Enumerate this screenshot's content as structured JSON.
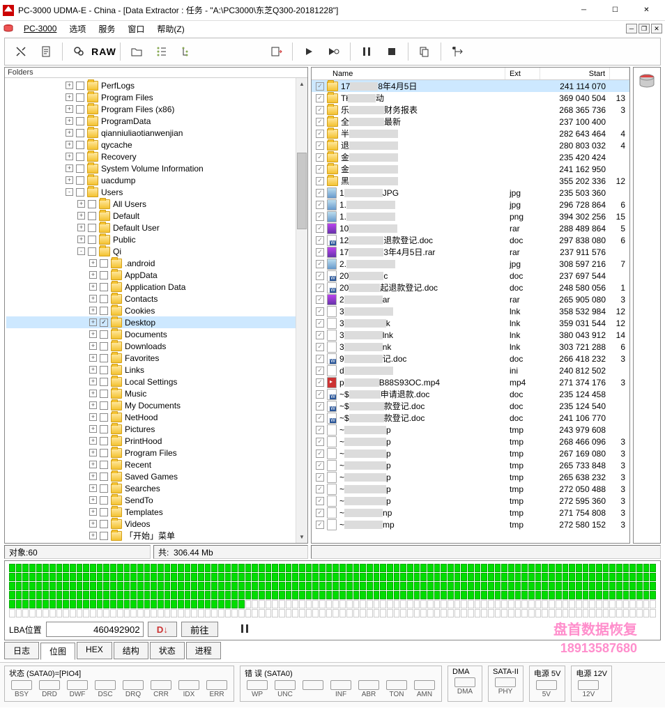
{
  "title": "PC-3000 UDMA-E - China - [Data Extractor : 任务 - \"A:\\PC3000\\东芝Q300-20181228\"]",
  "menus": {
    "app": "PC-3000",
    "items": [
      "选项",
      "服务",
      "窗口",
      "帮助(Z)"
    ]
  },
  "toolbar_raw": "RAW",
  "folders_title": "Folders",
  "tree": [
    {
      "indent": 5,
      "exp": "+",
      "cb": false,
      "label": "PerfLogs"
    },
    {
      "indent": 5,
      "exp": "+",
      "cb": false,
      "label": "Program Files"
    },
    {
      "indent": 5,
      "exp": "+",
      "cb": false,
      "label": "Program Files (x86)"
    },
    {
      "indent": 5,
      "exp": "+",
      "cb": false,
      "label": "ProgramData"
    },
    {
      "indent": 5,
      "exp": "+",
      "cb": false,
      "label": "qianniuliaotianwenjian"
    },
    {
      "indent": 5,
      "exp": "+",
      "cb": false,
      "label": "qycache"
    },
    {
      "indent": 5,
      "exp": "+",
      "cb": false,
      "label": "Recovery"
    },
    {
      "indent": 5,
      "exp": "+",
      "cb": false,
      "label": "System Volume Information"
    },
    {
      "indent": 5,
      "exp": "+",
      "cb": false,
      "label": "uacdump"
    },
    {
      "indent": 5,
      "exp": "-",
      "cb": false,
      "label": "Users"
    },
    {
      "indent": 6,
      "exp": "+",
      "cb": false,
      "label": "All Users"
    },
    {
      "indent": 6,
      "exp": "+",
      "cb": false,
      "label": "Default"
    },
    {
      "indent": 6,
      "exp": "+",
      "cb": false,
      "label": "Default User"
    },
    {
      "indent": 6,
      "exp": "+",
      "cb": false,
      "label": "Public"
    },
    {
      "indent": 6,
      "exp": "-",
      "cb": false,
      "label": "Qi"
    },
    {
      "indent": 7,
      "exp": "+",
      "cb": false,
      "label": ".android"
    },
    {
      "indent": 7,
      "exp": "+",
      "cb": false,
      "label": "AppData"
    },
    {
      "indent": 7,
      "exp": "+",
      "cb": false,
      "label": "Application Data"
    },
    {
      "indent": 7,
      "exp": "+",
      "cb": false,
      "label": "Contacts"
    },
    {
      "indent": 7,
      "exp": "+",
      "cb": false,
      "label": "Cookies"
    },
    {
      "indent": 7,
      "exp": "+",
      "cb": true,
      "label": "Desktop",
      "sel": true
    },
    {
      "indent": 7,
      "exp": "+",
      "cb": false,
      "label": "Documents"
    },
    {
      "indent": 7,
      "exp": "+",
      "cb": false,
      "label": "Downloads"
    },
    {
      "indent": 7,
      "exp": "+",
      "cb": false,
      "label": "Favorites"
    },
    {
      "indent": 7,
      "exp": "+",
      "cb": false,
      "label": "Links"
    },
    {
      "indent": 7,
      "exp": "+",
      "cb": false,
      "label": "Local Settings"
    },
    {
      "indent": 7,
      "exp": "+",
      "cb": false,
      "label": "Music"
    },
    {
      "indent": 7,
      "exp": "+",
      "cb": false,
      "label": "My Documents"
    },
    {
      "indent": 7,
      "exp": "+",
      "cb": false,
      "label": "NetHood"
    },
    {
      "indent": 7,
      "exp": "+",
      "cb": false,
      "label": "Pictures"
    },
    {
      "indent": 7,
      "exp": "+",
      "cb": false,
      "label": "PrintHood"
    },
    {
      "indent": 7,
      "exp": "+",
      "cb": false,
      "label": "Program Files"
    },
    {
      "indent": 7,
      "exp": "+",
      "cb": false,
      "label": "Recent"
    },
    {
      "indent": 7,
      "exp": "+",
      "cb": false,
      "label": "Saved Games"
    },
    {
      "indent": 7,
      "exp": "+",
      "cb": false,
      "label": "Searches"
    },
    {
      "indent": 7,
      "exp": "+",
      "cb": false,
      "label": "SendTo"
    },
    {
      "indent": 7,
      "exp": "+",
      "cb": false,
      "label": "Templates"
    },
    {
      "indent": 7,
      "exp": "+",
      "cb": false,
      "label": "Videos"
    },
    {
      "indent": 7,
      "exp": "+",
      "cb": false,
      "label": "「开始」菜单"
    }
  ],
  "cols": {
    "name": "Name",
    "ext": "Ext",
    "start": "Start"
  },
  "files": [
    {
      "ico": "folder",
      "pre": "17",
      "mid": 40,
      "post": "8年4月5日",
      "ext": "",
      "start": "241 114 070",
      "end": "",
      "sel": true
    },
    {
      "ico": "folder",
      "pre": "Tł",
      "mid": 40,
      "post": "动",
      "ext": "",
      "start": "369 040 504",
      "end": "13"
    },
    {
      "ico": "folder",
      "pre": "乐",
      "mid": 50,
      "post": "财务报表",
      "ext": "",
      "start": "268 365 736",
      "end": "3"
    },
    {
      "ico": "folder",
      "pre": "全",
      "mid": 50,
      "post": "最新",
      "ext": "",
      "start": "237 100 400",
      "end": ""
    },
    {
      "ico": "folder",
      "pre": "半",
      "mid": 70,
      "post": "",
      "ext": "",
      "start": "282 643 464",
      "end": "4"
    },
    {
      "ico": "folder",
      "pre": "退",
      "mid": 70,
      "post": "",
      "ext": "",
      "start": "280 803 032",
      "end": "4"
    },
    {
      "ico": "folder",
      "pre": "金",
      "mid": 70,
      "post": "",
      "ext": "",
      "start": "235 420 424",
      "end": ""
    },
    {
      "ico": "folder",
      "pre": "金",
      "mid": 70,
      "post": "",
      "ext": "",
      "start": "241 162 950",
      "end": ""
    },
    {
      "ico": "folder",
      "pre": "黑",
      "mid": 70,
      "post": "",
      "ext": "",
      "start": "355 202 336",
      "end": "12"
    },
    {
      "ico": "img",
      "pre": "1",
      "mid": 55,
      "post": "JPG",
      "ext": "jpg",
      "start": "235 503 360",
      "end": ""
    },
    {
      "ico": "img",
      "pre": "1.",
      "mid": 70,
      "post": "",
      "ext": "jpg",
      "start": "296 728 864",
      "end": "6"
    },
    {
      "ico": "img",
      "pre": "1.",
      "mid": 70,
      "post": "",
      "ext": "png",
      "start": "394 302 256",
      "end": "15"
    },
    {
      "ico": "rar",
      "pre": "10",
      "mid": 70,
      "post": "",
      "ext": "rar",
      "start": "288 489 864",
      "end": "5"
    },
    {
      "ico": "w",
      "pre": "12",
      "mid": 50,
      "post": "退款登记.doc",
      "ext": "doc",
      "start": "297 838 080",
      "end": "6"
    },
    {
      "ico": "rar",
      "pre": "17",
      "mid": 50,
      "post": "3年4月5日.rar",
      "ext": "rar",
      "start": "237 911 576",
      "end": ""
    },
    {
      "ico": "img",
      "pre": "2.",
      "mid": 70,
      "post": "",
      "ext": "jpg",
      "start": "308 597 216",
      "end": "7"
    },
    {
      "ico": "w",
      "pre": "20",
      "mid": 50,
      "post": "c",
      "ext": "doc",
      "start": "237 697 544",
      "end": ""
    },
    {
      "ico": "w",
      "pre": "20",
      "mid": 45,
      "post": "起退款登记.doc",
      "ext": "doc",
      "start": "248 580 056",
      "end": "1"
    },
    {
      "ico": "rar",
      "pre": "2",
      "mid": 55,
      "post": "ar",
      "ext": "rar",
      "start": "265 905 080",
      "end": "3"
    },
    {
      "ico": "file",
      "pre": "3",
      "mid": 70,
      "post": "",
      "ext": "lnk",
      "start": "358 532 984",
      "end": "12"
    },
    {
      "ico": "file",
      "pre": "3",
      "mid": 60,
      "post": "k",
      "ext": "lnk",
      "start": "359 031 544",
      "end": "12"
    },
    {
      "ico": "file",
      "pre": "3",
      "mid": 55,
      "post": "lnk",
      "ext": "lnk",
      "start": "380 043 912",
      "end": "14"
    },
    {
      "ico": "file",
      "pre": "3",
      "mid": 55,
      "post": "nk",
      "ext": "lnk",
      "start": "303 721 288",
      "end": "6"
    },
    {
      "ico": "w",
      "pre": "9",
      "mid": 55,
      "post": "记.doc",
      "ext": "doc",
      "start": "266 418 232",
      "end": "3"
    },
    {
      "ico": "file",
      "pre": "d",
      "mid": 70,
      "post": "",
      "ext": "ini",
      "start": "240 812 502",
      "end": ""
    },
    {
      "ico": "vid",
      "pre": "p",
      "mid": 50,
      "post": "B88S93OC.mp4",
      "ext": "mp4",
      "start": "271 374 176",
      "end": "3"
    },
    {
      "ico": "w",
      "pre": "~$",
      "mid": 45,
      "post": "申请退款.doc",
      "ext": "doc",
      "start": "235 124 458",
      "end": ""
    },
    {
      "ico": "w",
      "pre": "~$",
      "mid": 50,
      "post": "款登记.doc",
      "ext": "doc",
      "start": "235 124 540",
      "end": ""
    },
    {
      "ico": "w",
      "pre": "~$",
      "mid": 50,
      "post": "款登记.doc",
      "ext": "doc",
      "start": "241 106 770",
      "end": ""
    },
    {
      "ico": "file",
      "pre": "~",
      "mid": 60,
      "post": "p",
      "ext": "tmp",
      "start": "243 979 608",
      "end": ""
    },
    {
      "ico": "file",
      "pre": "~",
      "mid": 60,
      "post": "p",
      "ext": "tmp",
      "start": "268 466 096",
      "end": "3"
    },
    {
      "ico": "file",
      "pre": "~",
      "mid": 60,
      "post": "p",
      "ext": "tmp",
      "start": "267 169 080",
      "end": "3"
    },
    {
      "ico": "file",
      "pre": "~",
      "mid": 60,
      "post": "p",
      "ext": "tmp",
      "start": "265 733 848",
      "end": "3"
    },
    {
      "ico": "file",
      "pre": "~",
      "mid": 60,
      "post": "p",
      "ext": "tmp",
      "start": "265 638 232",
      "end": "3"
    },
    {
      "ico": "file",
      "pre": "~",
      "mid": 60,
      "post": "p",
      "ext": "tmp",
      "start": "272 050 488",
      "end": "3"
    },
    {
      "ico": "file",
      "pre": "~",
      "mid": 60,
      "post": "p",
      "ext": "tmp",
      "start": "272 595 360",
      "end": "3"
    },
    {
      "ico": "file",
      "pre": "~",
      "mid": 55,
      "post": "np",
      "ext": "tmp",
      "start": "271 754 808",
      "end": "3"
    },
    {
      "ico": "file",
      "pre": "~",
      "mid": 55,
      "post": "mp",
      "ext": "tmp",
      "start": "272 580 152",
      "end": "3"
    }
  ],
  "status": {
    "a_lbl": "对象:",
    "a_val": "60",
    "b_lbl": "共:",
    "b_val": "306.44 Mb"
  },
  "lba": {
    "label": "LBA位置",
    "value": "460492902",
    "go": "前往",
    "btn2": "D↓"
  },
  "tabs": [
    "日志",
    "位图",
    "HEX",
    "结构",
    "状态",
    "进程"
  ],
  "active_tab": 1,
  "groups": {
    "status0": {
      "title": "状态 (SATA0)=[PIO4]",
      "leds": [
        "BSY",
        "DRD",
        "DWF",
        "DSC",
        "DRQ",
        "CRR",
        "IDX",
        "ERR"
      ]
    },
    "err": {
      "title": "错 误 (SATA0)",
      "leds": [
        "WP",
        "UNC",
        "",
        "INF",
        "ABR",
        "TON",
        "AMN"
      ]
    },
    "dma": {
      "title": "DMA",
      "leds": [
        "DMA"
      ]
    },
    "sata2": {
      "title": "SATA-II",
      "leds": [
        "PHY"
      ]
    },
    "pwr5": {
      "title": "电源 5V",
      "leds": [
        "5V"
      ]
    },
    "pwr12": {
      "title": "电源 12V",
      "leds": [
        "12V"
      ]
    }
  },
  "watermark1": "盘首数据恢复",
  "watermark2": "18913587680"
}
